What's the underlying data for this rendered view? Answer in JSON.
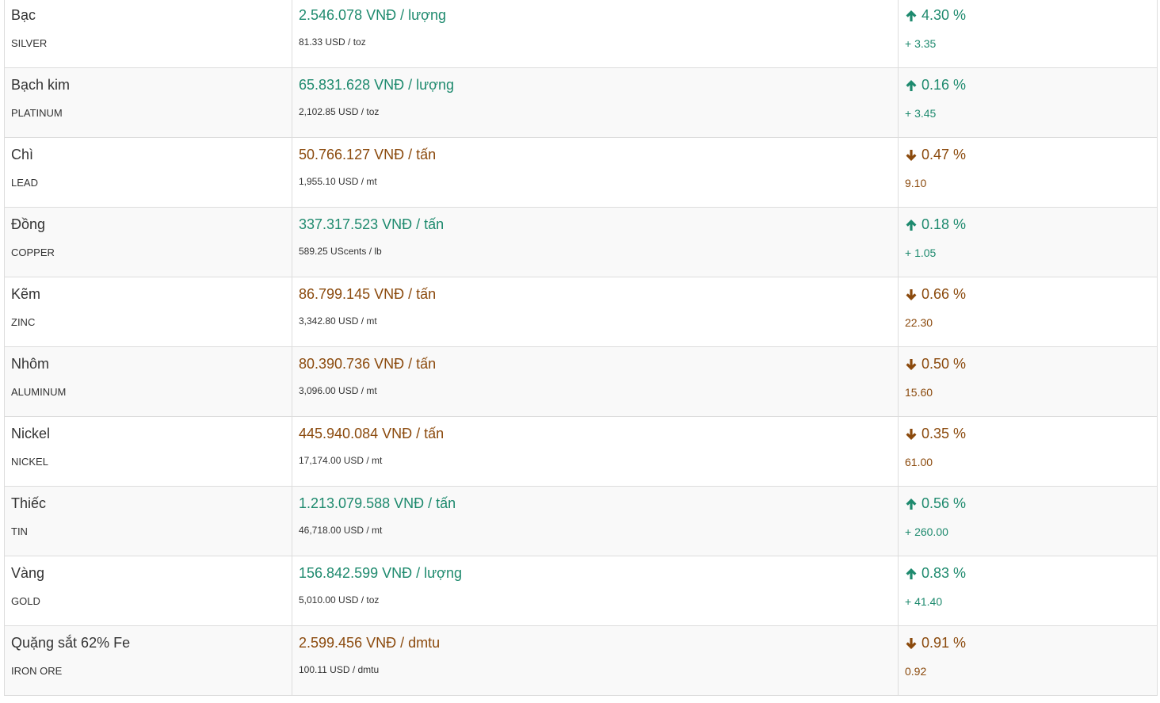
{
  "colors": {
    "up": "#1e8a6e",
    "down": "#8b4a0d",
    "text": "#333333",
    "border": "#dddddd",
    "stripe": "#f9f9f9"
  },
  "rows": [
    {
      "name": "Bạc",
      "code": "SILVER",
      "vnd": "2.546.078 VNĐ / lượng",
      "usd": "81.33 USD / toz",
      "direction": "up",
      "arrow_icon": "arrow-up-icon",
      "percent": "4.30 %",
      "change": "+ 3.35"
    },
    {
      "name": "Bạch kim",
      "code": "PLATINUM",
      "vnd": "65.831.628 VNĐ / lượng",
      "usd": "2,102.85 USD / toz",
      "direction": "up",
      "arrow_icon": "arrow-up-icon",
      "percent": "0.16 %",
      "change": "+ 3.45"
    },
    {
      "name": "Chì",
      "code": "LEAD",
      "vnd": "50.766.127 VNĐ / tấn",
      "usd": "1,955.10 USD / mt",
      "direction": "down",
      "arrow_icon": "arrow-down-icon",
      "percent": "0.47 %",
      "change": "9.10"
    },
    {
      "name": "Đồng",
      "code": "COPPER",
      "vnd": "337.317.523 VNĐ / tấn",
      "usd": "589.25 UScents / lb",
      "direction": "up",
      "arrow_icon": "arrow-up-icon",
      "percent": "0.18 %",
      "change": "+ 1.05"
    },
    {
      "name": "Kẽm",
      "code": "ZINC",
      "vnd": "86.799.145 VNĐ / tấn",
      "usd": "3,342.80 USD / mt",
      "direction": "down",
      "arrow_icon": "arrow-down-icon",
      "percent": "0.66 %",
      "change": "22.30"
    },
    {
      "name": "Nhôm",
      "code": "ALUMINUM",
      "vnd": "80.390.736 VNĐ / tấn",
      "usd": "3,096.00 USD / mt",
      "direction": "down",
      "arrow_icon": "arrow-down-icon",
      "percent": "0.50 %",
      "change": "15.60"
    },
    {
      "name": "Nickel",
      "code": "NICKEL",
      "vnd": "445.940.084 VNĐ / tấn",
      "usd": "17,174.00 USD / mt",
      "direction": "down",
      "arrow_icon": "arrow-down-icon",
      "percent": "0.35 %",
      "change": "61.00"
    },
    {
      "name": "Thiếc",
      "code": "TIN",
      "vnd": "1.213.079.588 VNĐ / tấn",
      "usd": "46,718.00 USD / mt",
      "direction": "up",
      "arrow_icon": "arrow-up-icon",
      "percent": "0.56 %",
      "change": "+ 260.00"
    },
    {
      "name": "Vàng",
      "code": "GOLD",
      "vnd": "156.842.599 VNĐ / lượng",
      "usd": "5,010.00 USD / toz",
      "direction": "up",
      "arrow_icon": "arrow-up-icon",
      "percent": "0.83 %",
      "change": "+ 41.40"
    },
    {
      "name": "Quặng sắt 62% Fe",
      "code": "IRON ORE",
      "vnd": "2.599.456 VNĐ / dmtu",
      "usd": "100.11 USD / dmtu",
      "direction": "down",
      "arrow_icon": "arrow-down-icon",
      "percent": "0.91 %",
      "change": "0.92"
    }
  ]
}
